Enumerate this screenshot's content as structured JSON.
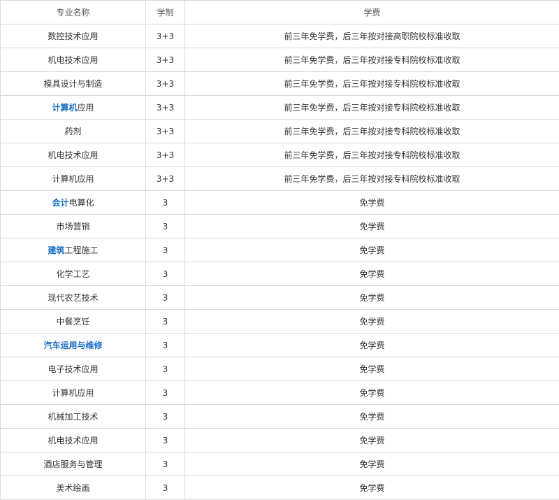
{
  "headers": {
    "major": "专业名称",
    "duration": "学制",
    "tuition": "学费"
  },
  "rows": [
    {
      "link": "",
      "rest": "数控技术应用",
      "duration": "3+3",
      "tuition": "前三年免学费，后三年按对接高职院校标准收取"
    },
    {
      "link": "",
      "rest": "机电技术应用",
      "duration": "3+3",
      "tuition": "前三年免学费，后三年按对接专科院校标准收取"
    },
    {
      "link": "",
      "rest": "模具设计与制造",
      "duration": "3+3",
      "tuition": "前三年免学费，后三年按对接专科院校标准收取"
    },
    {
      "link": "计算机",
      "rest": "应用",
      "duration": "3+3",
      "tuition": "前三年免学费，后三年按对接专科院校标准收取"
    },
    {
      "link": "",
      "rest": "药剂",
      "duration": "3+3",
      "tuition": "前三年免学费，后三年按对接专科院校标准收取"
    },
    {
      "link": "",
      "rest": "机电技术应用",
      "duration": "3+3",
      "tuition": "前三年免学费，后三年按对接专科院校标准收取"
    },
    {
      "link": "",
      "rest": "计算机应用",
      "duration": "3+3",
      "tuition": "前三年免学费，后三年按对接专科院校标准收取"
    },
    {
      "link": "会计",
      "rest": "电算化",
      "duration": "3",
      "tuition": "免学费"
    },
    {
      "link": "",
      "rest": "市场营销",
      "duration": "3",
      "tuition": "免学费"
    },
    {
      "link": "建筑",
      "rest": "工程施工",
      "duration": "3",
      "tuition": "免学费"
    },
    {
      "link": "",
      "rest": "化学工艺",
      "duration": "3",
      "tuition": "免学费"
    },
    {
      "link": "",
      "rest": "现代农艺技术",
      "duration": "3",
      "tuition": "免学费"
    },
    {
      "link": "",
      "rest": "中餐烹饪",
      "duration": "3",
      "tuition": "免学费"
    },
    {
      "link": "汽车运用与维修",
      "rest": "",
      "duration": "3",
      "tuition": "免学费"
    },
    {
      "link": "",
      "rest": "电子技术应用",
      "duration": "3",
      "tuition": "免学费"
    },
    {
      "link": "",
      "rest": "计算机应用",
      "duration": "3",
      "tuition": "免学费"
    },
    {
      "link": "",
      "rest": "机械加工技术",
      "duration": "3",
      "tuition": "免学费"
    },
    {
      "link": "",
      "rest": "机电技术应用",
      "duration": "3",
      "tuition": "免学费"
    },
    {
      "link": "",
      "rest": "酒店服务与管理",
      "duration": "3",
      "tuition": "免学费"
    },
    {
      "link": "",
      "rest": "美术绘画",
      "duration": "3",
      "tuition": "免学费"
    }
  ],
  "colors": {
    "border": "#d9d9d9",
    "text": "#333333",
    "keyword_link": "#1a6fc4"
  }
}
